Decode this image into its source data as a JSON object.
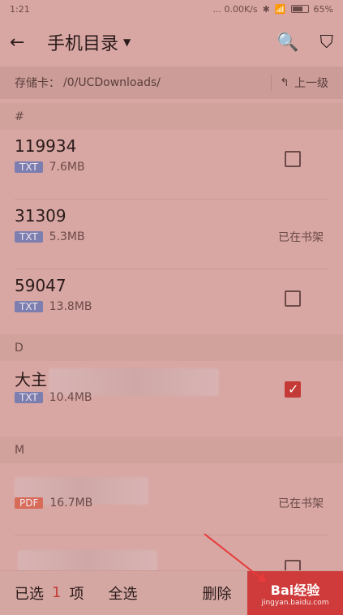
{
  "status": {
    "time": "1:21",
    "network": "... 0.00K/s",
    "battery": "65%"
  },
  "header": {
    "title": "手机目录",
    "back_icon": "arrow-left",
    "search_icon": "search",
    "filter_icon": "filter"
  },
  "path": {
    "prefix": "存储卡：",
    "value": "/0/UCDownloads/",
    "up_label": "上一级"
  },
  "sections": [
    {
      "label": "#"
    },
    {
      "label": "D"
    },
    {
      "label": "M"
    }
  ],
  "items": [
    {
      "name": "119934",
      "type": "TXT",
      "size": "7.6MB",
      "state": "unchecked"
    },
    {
      "name": "31309",
      "type": "TXT",
      "size": "5.3MB",
      "state": "on_shelf",
      "state_label": "已在书架"
    },
    {
      "name": "59047",
      "type": "TXT",
      "size": "13.8MB",
      "state": "unchecked"
    },
    {
      "name": "大主",
      "type": "TXT",
      "size": "10.4MB",
      "state": "checked"
    },
    {
      "name": "",
      "type": "PDF",
      "size": "16.7MB",
      "state": "on_shelf",
      "state_label": "已在书架"
    }
  ],
  "bottom": {
    "selected_prefix": "已选",
    "selected_count": "1",
    "selected_suffix": "项",
    "select_all": "全选",
    "delete": "删除",
    "brand_main": "Bai经验",
    "brand_sub": "jingyan.baidu.com"
  },
  "colors": {
    "accent": "#c43a36",
    "overlay": "#d8a7a3"
  }
}
